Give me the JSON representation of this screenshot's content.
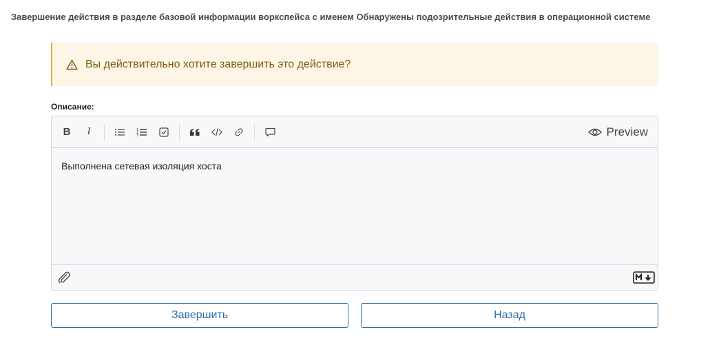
{
  "header": {
    "title": "Завершение действия в разделе базовой информации воркспейса с именем Обнаружены подозрительные действия в операционной системе"
  },
  "warning": {
    "icon": "warning-triangle-icon",
    "text": "Вы действительно хотите завершить это действие?",
    "accent_color": "#e8a73a"
  },
  "editor": {
    "label": "Описание:",
    "toolbar": {
      "bold": "B",
      "italic": "I",
      "preview_label": "Preview"
    },
    "content": "Выполнена сетевая изоляция хоста"
  },
  "actions": {
    "finish_label": "Завершить",
    "back_label": "Назад",
    "button_color": "#2d6ca2"
  }
}
